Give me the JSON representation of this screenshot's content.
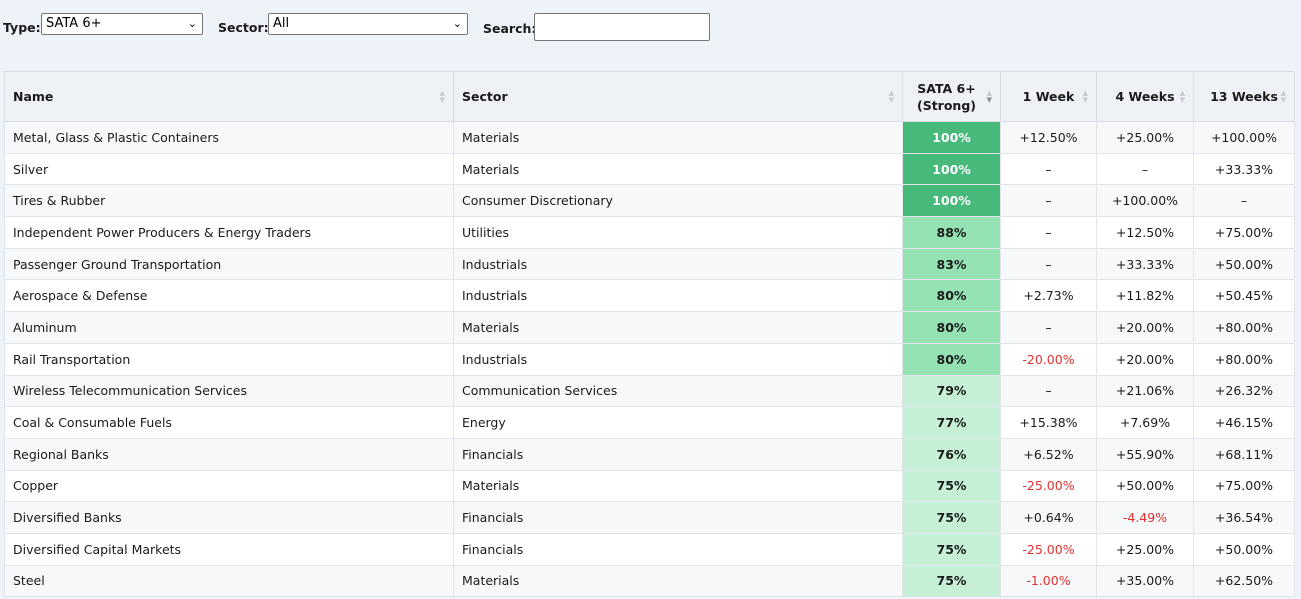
{
  "filters": {
    "type_label": "Type:",
    "type_value": "SATA 6+",
    "sector_label": "Sector:",
    "sector_value": "All",
    "search_label": "Search:",
    "search_value": ""
  },
  "table": {
    "columns": [
      "Name",
      "Sector",
      "SATA 6+",
      "(Strong)",
      "1 Week",
      "4 Weeks",
      "13 Weeks"
    ],
    "rows": [
      {
        "name": "Metal, Glass & Plastic Containers",
        "sector": "Materials",
        "score": "100%",
        "w1": "+12.50%",
        "w4": "+25.00%",
        "w13": "+100.00%",
        "bg": "#47b97b",
        "fg": "#ffffff"
      },
      {
        "name": "Silver",
        "sector": "Materials",
        "score": "100%",
        "w1": "–",
        "w4": "–",
        "w13": "+33.33%",
        "bg": "#47b97b",
        "fg": "#ffffff"
      },
      {
        "name": "Tires & Rubber",
        "sector": "Consumer Discretionary",
        "score": "100%",
        "w1": "–",
        "w4": "+100.00%",
        "w13": "–",
        "bg": "#47b97b",
        "fg": "#ffffff"
      },
      {
        "name": "Independent Power Producers & Energy Traders",
        "sector": "Utilities",
        "score": "88%",
        "w1": "–",
        "w4": "+12.50%",
        "w13": "+75.00%",
        "bg": "#94e1b3",
        "fg": "#1a1a1a"
      },
      {
        "name": "Passenger Ground Transportation",
        "sector": "Industrials",
        "score": "83%",
        "w1": "–",
        "w4": "+33.33%",
        "w13": "+50.00%",
        "bg": "#94e1b3",
        "fg": "#1a1a1a"
      },
      {
        "name": "Aerospace & Defense",
        "sector": "Industrials",
        "score": "80%",
        "w1": "+2.73%",
        "w4": "+11.82%",
        "w13": "+50.45%",
        "bg": "#94e1b3",
        "fg": "#1a1a1a"
      },
      {
        "name": "Aluminum",
        "sector": "Materials",
        "score": "80%",
        "w1": "–",
        "w4": "+20.00%",
        "w13": "+80.00%",
        "bg": "#94e1b3",
        "fg": "#1a1a1a"
      },
      {
        "name": "Rail Transportation",
        "sector": "Industrials",
        "score": "80%",
        "w1": "-20.00%",
        "w4": "+20.00%",
        "w13": "+80.00%",
        "bg": "#94e1b3",
        "fg": "#1a1a1a"
      },
      {
        "name": "Wireless Telecommunication Services",
        "sector": "Communication Services",
        "score": "79%",
        "w1": "–",
        "w4": "+21.06%",
        "w13": "+26.32%",
        "bg": "#c6f0d6",
        "fg": "#1a1a1a"
      },
      {
        "name": "Coal & Consumable Fuels",
        "sector": "Energy",
        "score": "77%",
        "w1": "+15.38%",
        "w4": "+7.69%",
        "w13": "+46.15%",
        "bg": "#c6f0d6",
        "fg": "#1a1a1a"
      },
      {
        "name": "Regional Banks",
        "sector": "Financials",
        "score": "76%",
        "w1": "+6.52%",
        "w4": "+55.90%",
        "w13": "+68.11%",
        "bg": "#c6f0d6",
        "fg": "#1a1a1a"
      },
      {
        "name": "Copper",
        "sector": "Materials",
        "score": "75%",
        "w1": "-25.00%",
        "w4": "+50.00%",
        "w13": "+75.00%",
        "bg": "#c6f0d6",
        "fg": "#1a1a1a"
      },
      {
        "name": "Diversified Banks",
        "sector": "Financials",
        "score": "75%",
        "w1": "+0.64%",
        "w4": "-4.49%",
        "w13": "+36.54%",
        "bg": "#c6f0d6",
        "fg": "#1a1a1a"
      },
      {
        "name": "Diversified Capital Markets",
        "sector": "Financials",
        "score": "75%",
        "w1": "-25.00%",
        "w4": "+25.00%",
        "w13": "+50.00%",
        "bg": "#c6f0d6",
        "fg": "#1a1a1a"
      },
      {
        "name": "Steel",
        "sector": "Materials",
        "score": "75%",
        "w1": "-1.00%",
        "w4": "+35.00%",
        "w13": "+62.50%",
        "bg": "#c6f0d6",
        "fg": "#1a1a1a"
      }
    ]
  },
  "colors": {
    "negative": "#e03131",
    "strong": "#47b97b",
    "medium": "#94e1b3",
    "light": "#c6f0d6"
  }
}
